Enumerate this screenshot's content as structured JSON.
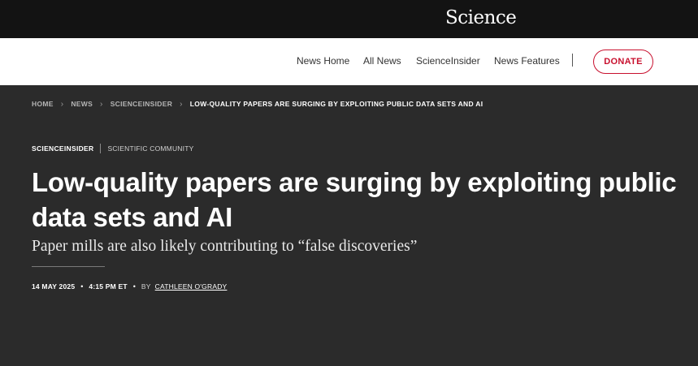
{
  "header": {
    "logo": "Science"
  },
  "nav": {
    "links": [
      "News Home",
      "All News",
      "ScienceInsider",
      "News Features"
    ],
    "donate": "DONATE"
  },
  "breadcrumb": {
    "items": [
      "HOME",
      "NEWS",
      "SCIENCEINSIDER"
    ],
    "current": "LOW-QUALITY PAPERS ARE SURGING BY EXPLOITING PUBLIC DATA SETS AND AI"
  },
  "article": {
    "section": "SCIENCEINSIDER",
    "category": "SCIENTIFIC COMMUNITY",
    "title": "Low-quality papers are surging by exploiting public data sets and AI",
    "subtitle": "Paper mills are also likely contributing to “false discoveries”",
    "date": "14 MAY 2025",
    "time": "4:15 PM ET",
    "by_label": "BY",
    "author": "CATHLEEN O'GRADY"
  },
  "colors": {
    "accent": "#c8102e",
    "page_background": "#2b2b2b",
    "top_bar": "#131313"
  }
}
